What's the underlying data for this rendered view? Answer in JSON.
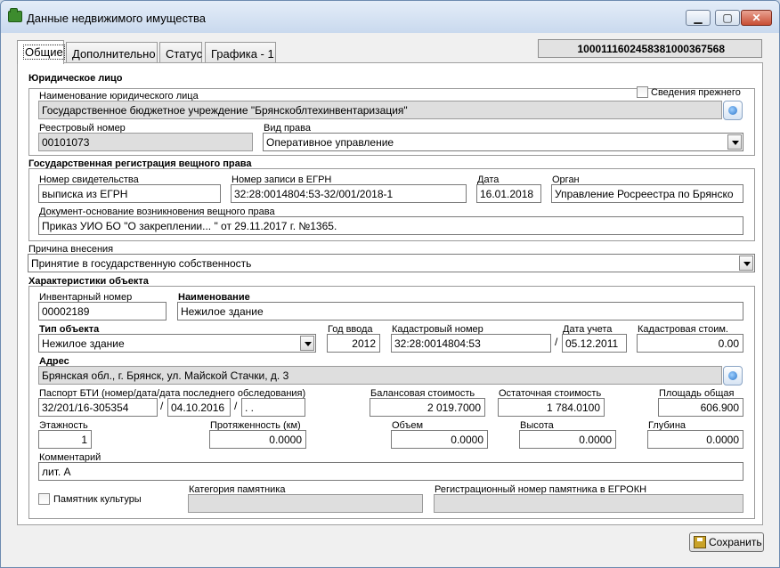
{
  "window": {
    "title": "Данные недвижимого имущества"
  },
  "tabs": [
    "Общие",
    "Дополнительно",
    "Статус",
    "Графика - 1"
  ],
  "record_id": "1000111602458381000367568",
  "legal_entity": {
    "section": "Юридическое лицо",
    "name_label": "Наименование юридического лица",
    "name_value": "Государственное бюджетное учреждение \"Брянскоблтехинвентаризация\"",
    "prev_label": "Сведения прежнего",
    "reg_label": "Реестровый номер",
    "reg_value": "00101073",
    "right_label": "Вид права",
    "right_value": "Оперативное управление"
  },
  "registration": {
    "section": "Государственная регистрация вещного права",
    "cert_label": "Номер свидетельства",
    "cert_value": "выписка из ЕГРН",
    "egrn_label": "Номер записи в ЕГРН",
    "egrn_value": "32:28:0014804:53-32/001/2018-1",
    "date_label": "Дата",
    "date_value": "16.01.2018",
    "organ_label": "Орган",
    "organ_value": "Управление Росреестра по Брянско",
    "doc_label": "Документ-основание возникновения вещного права",
    "doc_value": "Приказ УИО БО \"О закреплении... \" от 29.11.2017 г. №1365."
  },
  "reason": {
    "label": "Причина внесения",
    "value": "Принятие в государственную собственность"
  },
  "object": {
    "section": "Характеристики объекта",
    "inv_label": "Инвентарный номер",
    "inv_value": "00002189",
    "name_label": "Наименование",
    "name_value": "Нежилое здание",
    "type_label": "Тип объекта",
    "type_value": "Нежилое здание",
    "year_label": "Год ввода",
    "year_value": "2012",
    "cad_label": "Кадастровый номер",
    "cad_value": "32:28:0014804:53",
    "cad_sep": "/",
    "acc_date_label": "Дата учета",
    "acc_date_value": "05.12.2011",
    "cad_cost_label": "Кадастровая стоим.",
    "cad_cost_value": "0.00",
    "addr_label": "Адрес",
    "addr_value": "Брянская обл., г. Брянск, ул. Майской Стачки, д. 3",
    "bti_label": "Паспорт БТИ (номер/дата/дата последнего обследования)",
    "bti_number": "32/201/16-305354",
    "bti_sep1": "/",
    "bti_date": "04.10.2016",
    "bti_sep2": "/",
    "bti_last": " . .",
    "book_label": "Балансовая стоимость",
    "book_value": "2 019.7000",
    "resid_label": "Остаточная стоимость",
    "resid_value": "1 784.0100",
    "area_label": "Площадь общая",
    "area_value": "606.900",
    "floors_label": "Этажность",
    "floors_value": "1",
    "length_label": "Протяженность (км)",
    "length_value": "0.0000",
    "volume_label": "Объем",
    "volume_value": "0.0000",
    "height_label": "Высота",
    "height_value": "0.0000",
    "depth_label": "Глубина",
    "depth_value": "0.0000",
    "comment_label": "Комментарий",
    "comment_value": "лит. А",
    "monument_label": "Памятник культуры",
    "cat_label": "Категория памятника",
    "cat_value": "",
    "egrokn_label": "Регистрационный номер памятника в ЕГРОКН",
    "egrokn_value": ""
  },
  "footer": {
    "save_label": "Сохранить"
  }
}
